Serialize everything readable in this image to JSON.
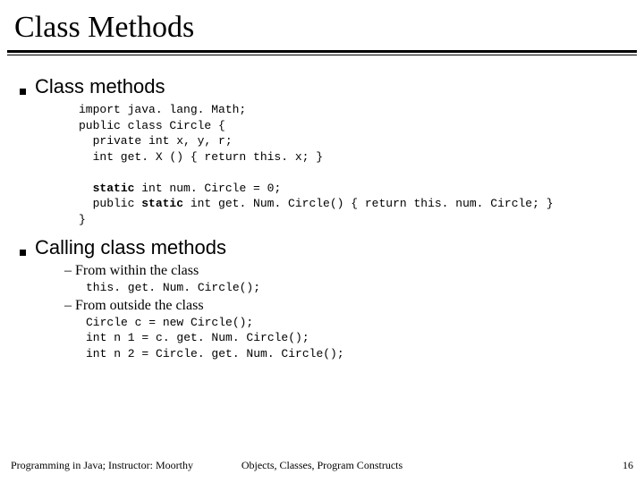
{
  "title": "Class Methods",
  "bullets": {
    "b1": "Class methods",
    "b2": "Calling class methods"
  },
  "code1": {
    "l1": "import java. lang. Math;",
    "l2": "public class Circle {",
    "l3": "  private int x, y, r;",
    "l4": "  int get. X () { return this. x; }",
    "l5": "",
    "l6a": "  ",
    "l6b": "static",
    "l6c": " int num. Circle = 0;",
    "l7a": "  public ",
    "l7b": "static",
    "l7c": " int get. Num. Circle() { return this. num. Circle; }",
    "l8": "}"
  },
  "sub": {
    "s1": "– From within the class",
    "s2": "– From outside the class"
  },
  "code2": {
    "l1": "this. get. Num. Circle();"
  },
  "code3": {
    "l1": "Circle c = new Circle();",
    "l2": "int n 1 = c. get. Num. Circle();",
    "l3": "int n 2 = Circle. get. Num. Circle();"
  },
  "footer": {
    "left": "Programming in Java; Instructor: Moorthy",
    "center": "Objects, Classes, Program Constructs",
    "right": "16"
  }
}
